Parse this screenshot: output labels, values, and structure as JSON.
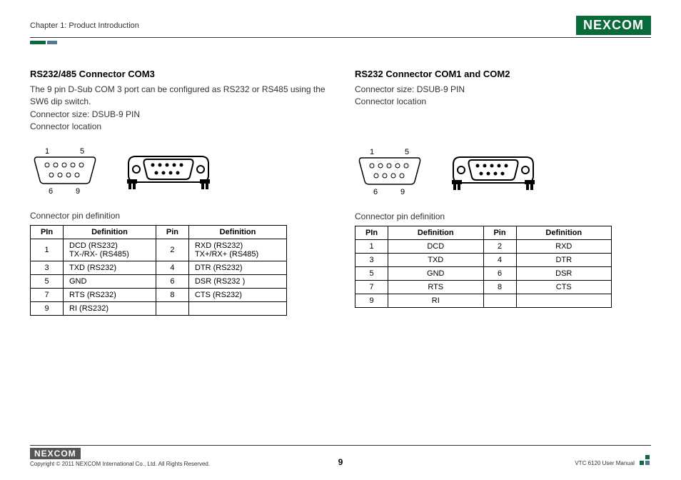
{
  "header": {
    "chapter": "Chapter 1: Product Introduction",
    "brand": "NEXCOM"
  },
  "left": {
    "title": "RS232/485 Connector COM3",
    "p1": "The 9 pin D-Sub COM 3 port can be configured as RS232 or RS485 using the SW6 dip switch.",
    "p2": "Connector size: DSUB-9 PIN",
    "p3": "Connector location",
    "diagram": {
      "tl": "1",
      "tr": "5",
      "bl": "6",
      "br": "9"
    },
    "tableTitle": "Connector pin definition",
    "th": {
      "a": "PIn",
      "b": "Definition",
      "c": "Pin",
      "d": "Definition"
    },
    "rows": [
      {
        "a": "1",
        "b": "DCD (RS232)\nTX-/RX- (RS485)",
        "c": "2",
        "d": "RXD (RS232)\nTX+/RX+ (RS485)"
      },
      {
        "a": "3",
        "b": "TXD (RS232)",
        "c": "4",
        "d": "DTR (RS232)"
      },
      {
        "a": "5",
        "b": "GND",
        "c": "6",
        "d": "DSR (RS232 )"
      },
      {
        "a": "7",
        "b": "RTS (RS232)",
        "c": "8",
        "d": "CTS (RS232)"
      },
      {
        "a": "9",
        "b": "RI (RS232)",
        "c": "",
        "d": ""
      }
    ]
  },
  "right": {
    "title": "RS232 Connector COM1 and COM2",
    "p1": "Connector size: DSUB-9 PIN",
    "p2": "Connector location",
    "diagram": {
      "tl": "1",
      "tr": "5",
      "bl": "6",
      "br": "9"
    },
    "tableTitle": "Connector pin definition",
    "th": {
      "a": "PIn",
      "b": "Definition",
      "c": "Pin",
      "d": "Definition"
    },
    "rows": [
      {
        "a": "1",
        "b": "DCD",
        "c": "2",
        "d": "RXD"
      },
      {
        "a": "3",
        "b": "TXD",
        "c": "4",
        "d": "DTR"
      },
      {
        "a": "5",
        "b": "GND",
        "c": "6",
        "d": "DSR"
      },
      {
        "a": "7",
        "b": "RTS",
        "c": "8",
        "d": "CTS"
      },
      {
        "a": "9",
        "b": "RI",
        "c": "",
        "d": ""
      }
    ]
  },
  "footer": {
    "brand": "NEXCOM",
    "copyright": "Copyright © 2011 NEXCOM International Co., Ltd. All Rights Reserved.",
    "page": "9",
    "manual": "VTC 6120 User Manual"
  }
}
